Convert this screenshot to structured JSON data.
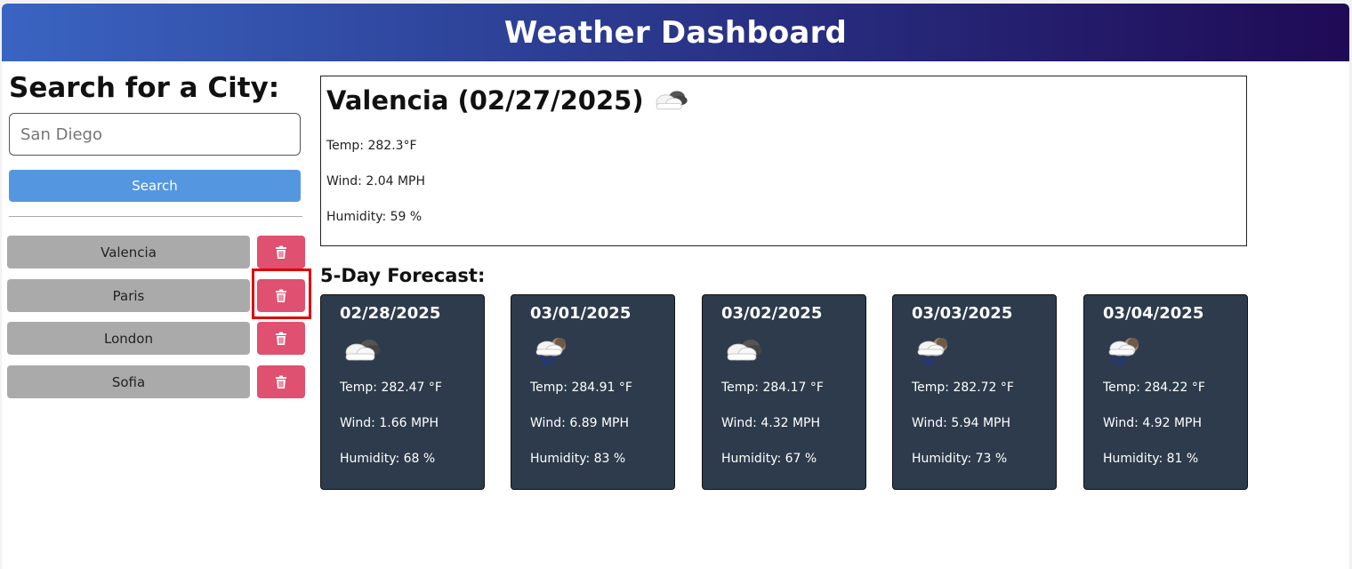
{
  "header": {
    "title": "Weather Dashboard"
  },
  "search": {
    "title": "Search for a City:",
    "placeholder": "San Diego",
    "button_label": "Search"
  },
  "history": [
    {
      "city": "Valencia",
      "delete_icon": "trash-icon"
    },
    {
      "city": "Paris",
      "delete_icon": "trash-icon"
    },
    {
      "city": "London",
      "delete_icon": "trash-icon"
    },
    {
      "city": "Sofia",
      "delete_icon": "trash-icon"
    }
  ],
  "current": {
    "title": "Valencia (02/27/2025)",
    "icon": "cloud-icon",
    "temp": "Temp: 282.3°F",
    "wind": "Wind: 2.04 MPH",
    "humidity": "Humidity: 59 %"
  },
  "forecast": {
    "title": "5-Day Forecast:",
    "days": [
      {
        "date": "02/28/2025",
        "icon": "cloud-icon",
        "temp": "Temp: 282.47 °F",
        "wind": "Wind: 1.66 MPH",
        "humidity": "Humidity: 68 %"
      },
      {
        "date": "03/01/2025",
        "icon": "rain-icon",
        "temp": "Temp: 284.91 °F",
        "wind": "Wind: 6.89 MPH",
        "humidity": "Humidity: 83 %"
      },
      {
        "date": "03/02/2025",
        "icon": "cloud-icon",
        "temp": "Temp: 284.17 °F",
        "wind": "Wind: 4.32 MPH",
        "humidity": "Humidity: 67 %"
      },
      {
        "date": "03/03/2025",
        "icon": "rain-icon",
        "temp": "Temp: 282.72 °F",
        "wind": "Wind: 5.94 MPH",
        "humidity": "Humidity: 73 %"
      },
      {
        "date": "03/04/2025",
        "icon": "rain-icon",
        "temp": "Temp: 284.22 °F",
        "wind": "Wind: 4.92 MPH",
        "humidity": "Humidity: 81 %"
      }
    ]
  },
  "colors": {
    "header_start": "#3a64c2",
    "header_end": "#1f0a55",
    "search_button": "#5596e0",
    "delete_button": "#e05070",
    "city_button": "#aaaaaa",
    "card_background": "#2d3b4c",
    "highlight": "#e00000"
  }
}
